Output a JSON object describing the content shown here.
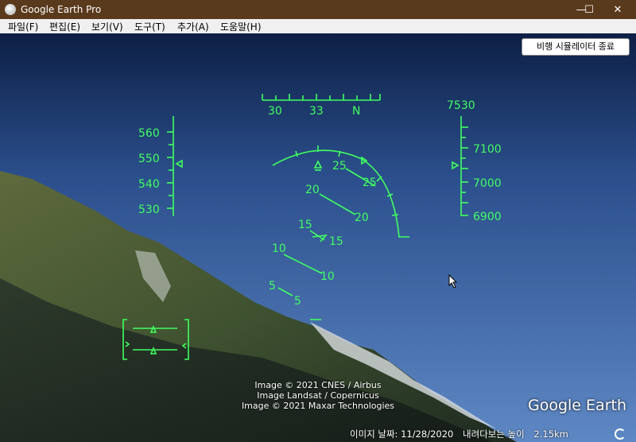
{
  "window": {
    "title": "Google Earth Pro",
    "minimize": "—",
    "maximize": "☐",
    "close": "✕"
  },
  "menu": [
    "파일(F)",
    "편집(E)",
    "보기(V)",
    "도구(T)",
    "추가(A)",
    "도움말(H)"
  ],
  "sim_exit_label": "비행 시뮬레이터 종료",
  "hud": {
    "heading_labels": [
      "30",
      "33",
      "N"
    ],
    "speed_labels": [
      "560",
      "550",
      "540",
      "530"
    ],
    "altitude_top": "7530",
    "altitude_labels": [
      "7100",
      "7000",
      "6900"
    ],
    "pitch_labels": [
      "25",
      "25",
      "20",
      "20",
      "15",
      "15",
      "10",
      "10",
      "5",
      "5"
    ]
  },
  "credits": [
    "Image © 2021 CNES / Airbus",
    "Image Landsat / Copernicus",
    "Image © 2021 Maxar Technologies"
  ],
  "logo": "Google Earth",
  "status": {
    "image_date": "이미지 날짜: 11/28/2020",
    "eye_alt_label": "내려다보는 높이",
    "eye_alt_value": "2.15km"
  }
}
